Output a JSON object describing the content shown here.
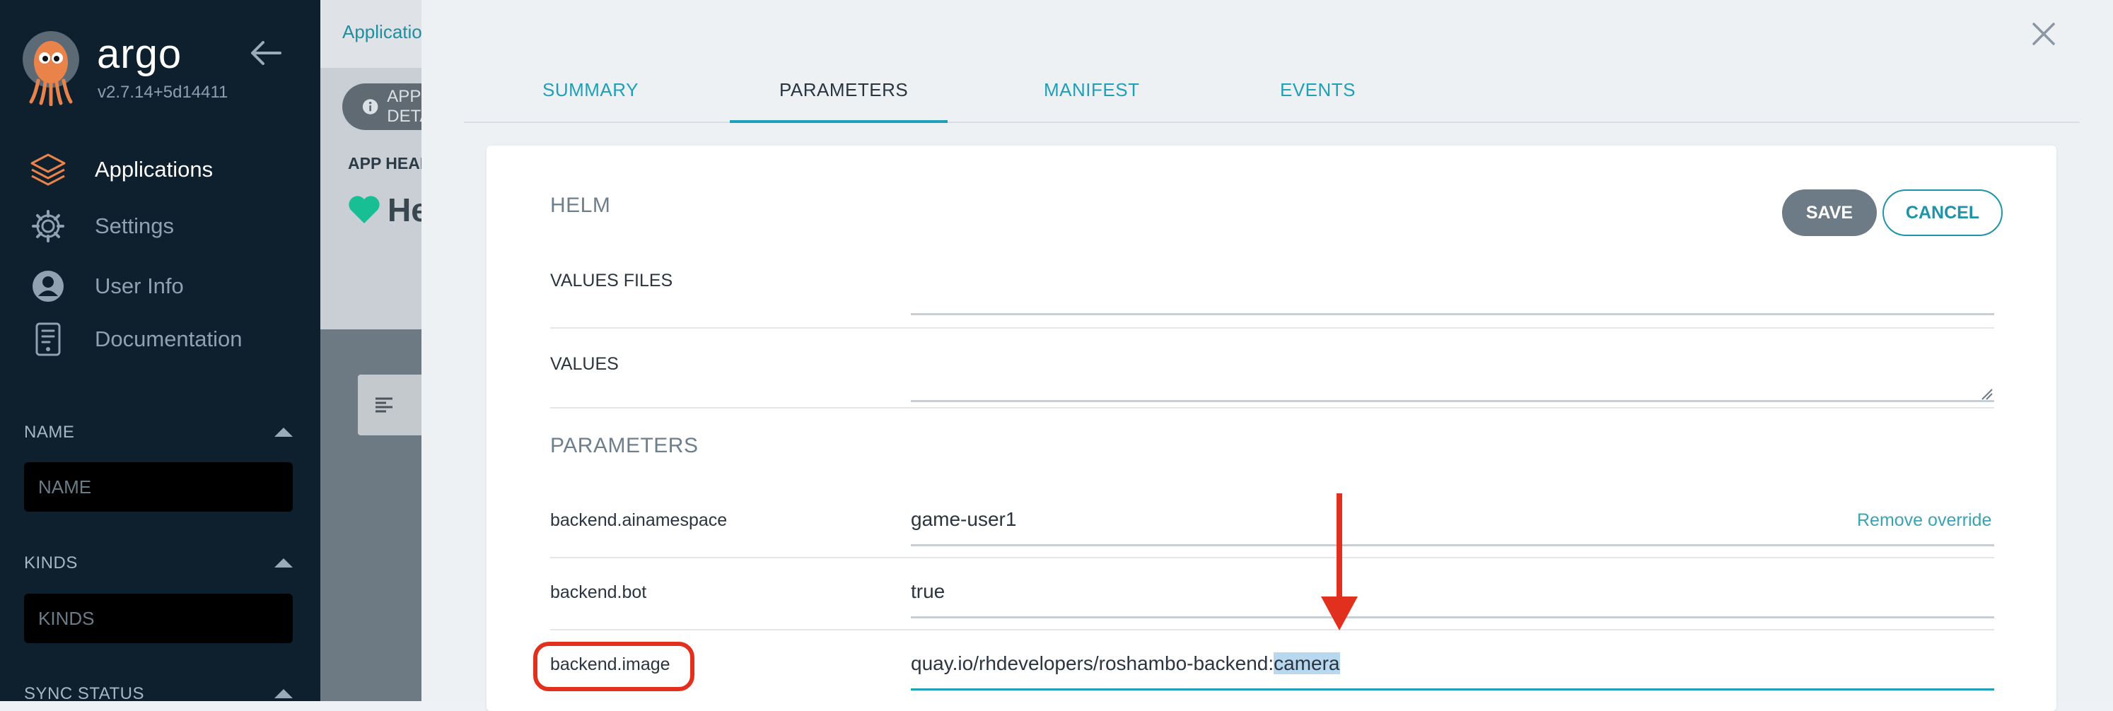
{
  "sidebar": {
    "brand": {
      "name": "argo",
      "version": "v2.7.14+5d14411"
    },
    "nav": [
      {
        "label": "Applications",
        "icon": "layers-icon",
        "active": true
      },
      {
        "label": "Settings",
        "icon": "gear-icon",
        "active": false
      },
      {
        "label": "User Info",
        "icon": "user-circle-icon",
        "active": false
      },
      {
        "label": "Documentation",
        "icon": "book-icon",
        "active": false
      }
    ],
    "filters": {
      "name": {
        "title": "NAME",
        "placeholder": "NAME"
      },
      "kinds": {
        "title": "KINDS",
        "placeholder": "KINDS"
      },
      "sync_status": {
        "title": "SYNC STATUS"
      }
    }
  },
  "background_app": {
    "breadcrumb": "Applications",
    "details_button": "APP DETAILS",
    "header_label": "APP HEALTH",
    "health_text": "He"
  },
  "panel": {
    "tabs": [
      {
        "label": "SUMMARY",
        "active": false
      },
      {
        "label": "PARAMETERS",
        "active": true
      },
      {
        "label": "MANIFEST",
        "active": false
      },
      {
        "label": "EVENTS",
        "active": false
      }
    ],
    "helm": {
      "section_title": "HELM",
      "save_label": "SAVE",
      "cancel_label": "CANCEL",
      "values_files_label": "VALUES FILES",
      "values_label": "VALUES"
    },
    "parameters": {
      "section_title": "PARAMETERS",
      "remove_override_label": "Remove override",
      "rows": [
        {
          "name": "backend.ainamespace",
          "value": "game-user1"
        },
        {
          "name": "backend.bot",
          "value": "true"
        },
        {
          "name": "backend.image",
          "value_prefix": "quay.io/rhdevelopers/roshambo-backend:",
          "value_selected": "camera"
        }
      ]
    }
  },
  "colors": {
    "sidebar_bg": "#0e1f2e",
    "accent": "#1fa0b8",
    "annotation": "#e2301f",
    "health_green": "#18be94"
  }
}
